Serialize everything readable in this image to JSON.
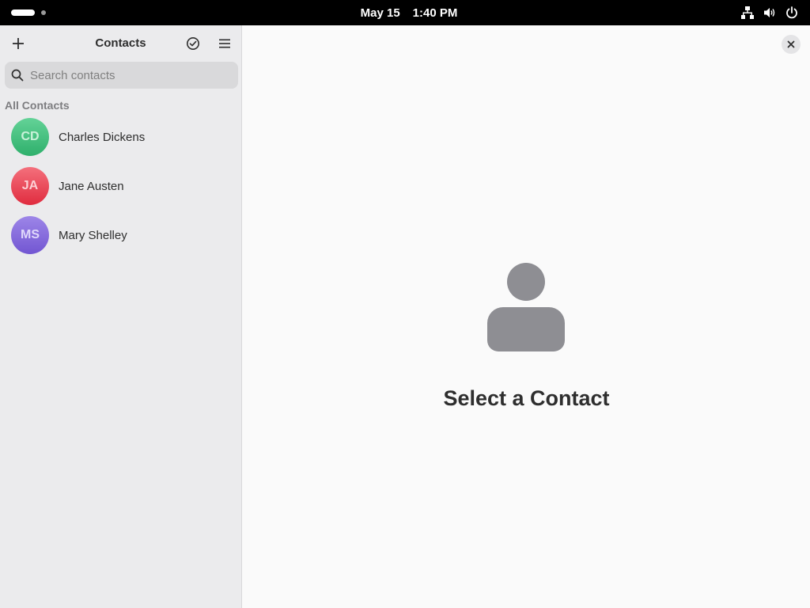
{
  "topbar": {
    "date": "May 15",
    "time": "1:40 PM",
    "icons": [
      "network-icon",
      "volume-icon",
      "power-icon"
    ]
  },
  "sidebar": {
    "title": "Contacts",
    "search_placeholder": "Search contacts",
    "section_label": "All Contacts",
    "contacts": [
      {
        "initials": "CD",
        "name": "Charles Dickens",
        "avatar_top": "#63d297",
        "avatar_bottom": "#2fb06c",
        "initials_color": "#c9f2d9"
      },
      {
        "initials": "JA",
        "name": "Jane Austen",
        "avatar_top": "#f4707c",
        "avatar_bottom": "#e02c3f",
        "initials_color": "#fcd0d4"
      },
      {
        "initials": "MS",
        "name": "Mary Shelley",
        "avatar_top": "#9d86e8",
        "avatar_bottom": "#7256d2",
        "initials_color": "#e0d8fb"
      }
    ]
  },
  "main": {
    "empty_state_title": "Select a Contact"
  }
}
